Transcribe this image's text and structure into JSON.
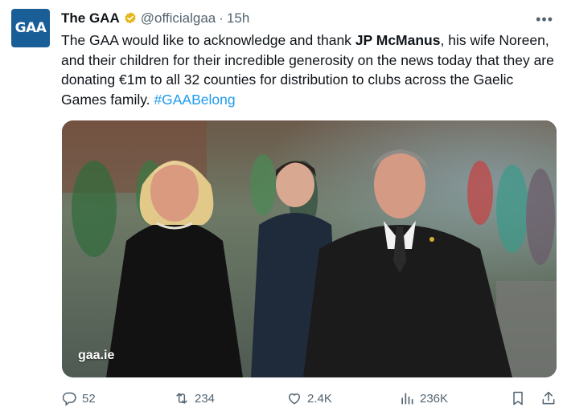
{
  "author": {
    "display_name": "The GAA",
    "handle": "@officialgaa",
    "separator": "·",
    "time": "15h",
    "avatar_text": "GAA",
    "verified": true,
    "avatar_color": "#1a5e98",
    "verified_color": "#e2b719"
  },
  "tweet": {
    "text_1": "The GAA would like to acknowledge and thank ",
    "text_bold": "JP McManus",
    "text_2": ", his wife Noreen, and their children for their incredible generosity on the news today that they are donating €1m to all 32 counties for distribution to clubs across the Gaelic Games family. ",
    "hashtag": "#GAABelong"
  },
  "media": {
    "watermark": "gaa.ie"
  },
  "actions": {
    "replies": "52",
    "retweets": "234",
    "likes": "2.4K",
    "views": "236K"
  },
  "colors": {
    "link": "#1d9bf0",
    "secondary_text": "#536471",
    "primary_text": "#0f1419"
  }
}
